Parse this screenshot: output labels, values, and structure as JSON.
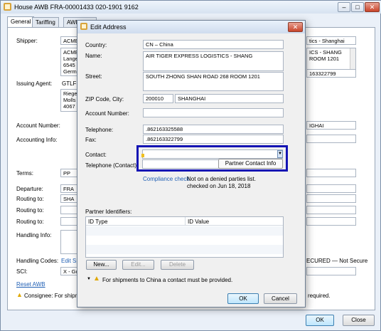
{
  "window": {
    "title": "House AWB FRA-00001433 020-1901 9162"
  },
  "tabs": [
    "General",
    "Tariffing",
    "AWB Print"
  ],
  "bg": {
    "labels": {
      "shipper": "Shipper:",
      "issuing_agent": "Issuing Agent:",
      "account_number": "Account Number:",
      "accounting_info": "Accounting Info:",
      "terms": "Terms:",
      "departure": "Departure:",
      "routing1": "Routing to:",
      "routing2": "Routing to:",
      "routing3": "Routing to:",
      "handling_info": "Handling Info:",
      "handling_codes": "Handling Codes:",
      "sci": "SCI:"
    },
    "shipper_value": "ACME",
    "shipper_addr": [
      "ACME",
      "Lange",
      "6545",
      "Germa"
    ],
    "issuing_agent_value": "GTLFRA",
    "agent_addr": [
      "Riege",
      "Molls",
      "4067"
    ],
    "terms_value": "PP",
    "departure_value": "FRA",
    "routing1_value": "SHA",
    "handling_codes_link": "Edit Sp",
    "sci_value": "X - Go",
    "reset_link": "Reset AWB",
    "consignee_warning": "Consignee: For shipm",
    "right_consignee_name": "tics - Shanghai",
    "right_addr": [
      "ICS - SHANG",
      "ROOM 1201"
    ],
    "right_phone": "163322799",
    "right_city": "IGHAI",
    "secured": "ECURED — Not Secure",
    "required": "required.",
    "ok": "OK",
    "close": "Close"
  },
  "dialog": {
    "title": "Edit Address",
    "country_label": "Country:",
    "country_value": "CN – China",
    "name_label": "Name:",
    "name_value": "AIR TIGER EXPRESS LOGISTICS - SHANG",
    "street_label": "Street:",
    "street_value": "SOUTH ZHONG SHAN ROAD 268 ROOM 1201",
    "zip_label": "ZIP Code, City:",
    "zip_value": "200010",
    "city_value": "SHANGHAI",
    "account_label": "Account Number:",
    "account_value": "",
    "telephone_label": "Telephone:",
    "telephone_value": ".862163325588",
    "fax_label": "Fax:",
    "fax_value": ".862163322799",
    "contact_label": "Contact:",
    "contact_value": "",
    "tel_contact_label": "Telephone (Contact):",
    "partner_contact_info": "Partner Contact Info",
    "compliance_link": "Compliance check",
    "compliance_text": "Not on a denied parties list.",
    "compliance_date": "checked on Jun 18, 2018",
    "partner_ids_label": "Partner Identifiers:",
    "col_id_type": "ID Type",
    "col_id_value": "ID Value",
    "new_btn": "New...",
    "edit_btn": "Edit...",
    "delete_btn": "Delete",
    "warning": "For shipments to China a contact must be provided.",
    "ok": "OK",
    "cancel": "Cancel"
  },
  "colors": {
    "highlight": "#1414b4",
    "link": "#1f5fb4",
    "warning": "#f2b800"
  }
}
